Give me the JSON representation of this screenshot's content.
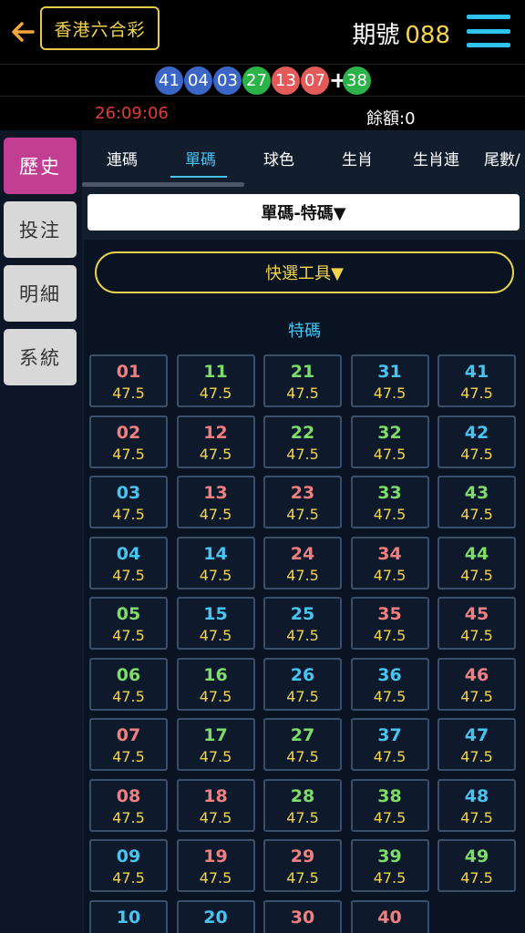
{
  "header": {
    "lottery_name": "香港六合彩",
    "period_label": "期號",
    "period_number": "088",
    "back_icon": "arrow-left-icon",
    "menu_icon": "hamburger-menu-icon"
  },
  "last_draw": {
    "balls": [
      {
        "number": "41",
        "color": "#3b66c8"
      },
      {
        "number": "04",
        "color": "#3b66c8"
      },
      {
        "number": "03",
        "color": "#3b66c8"
      },
      {
        "number": "27",
        "color": "#2bb34a"
      },
      {
        "number": "13",
        "color": "#e35a5a"
      },
      {
        "number": "07",
        "color": "#e35a5a"
      }
    ],
    "plus": "+",
    "special": {
      "number": "38",
      "color": "#2bb34a"
    }
  },
  "status": {
    "countdown": "26:09:06",
    "balance": "餘額:0"
  },
  "sidebar": {
    "items": [
      {
        "label": "歷史",
        "active": true
      },
      {
        "label": "投注",
        "active": false
      },
      {
        "label": "明細",
        "active": false
      },
      {
        "label": "系統",
        "active": false
      }
    ]
  },
  "tabs": [
    {
      "label": "連碼",
      "active": false
    },
    {
      "label": "單碼",
      "active": true
    },
    {
      "label": "球色",
      "active": false
    },
    {
      "label": "生肖",
      "active": false
    },
    {
      "label": "生肖連",
      "active": false
    },
    {
      "label": "尾數/",
      "active": false
    }
  ],
  "selector": {
    "label": "單碼-特碼▼"
  },
  "quick_tool": {
    "label": "快選工具▼"
  },
  "section": {
    "title": "特碼"
  },
  "colors": {
    "red": "#f08080",
    "blue": "#49c3f0",
    "green": "#7ddc6a",
    "odds": "#f2d44d"
  },
  "numbers": [
    {
      "n": "01",
      "c": "red",
      "odds": "47.5"
    },
    {
      "n": "11",
      "c": "green",
      "odds": "47.5"
    },
    {
      "n": "21",
      "c": "green",
      "odds": "47.5"
    },
    {
      "n": "31",
      "c": "blue",
      "odds": "47.5"
    },
    {
      "n": "41",
      "c": "blue",
      "odds": "47.5"
    },
    {
      "n": "02",
      "c": "red",
      "odds": "47.5"
    },
    {
      "n": "12",
      "c": "red",
      "odds": "47.5"
    },
    {
      "n": "22",
      "c": "green",
      "odds": "47.5"
    },
    {
      "n": "32",
      "c": "green",
      "odds": "47.5"
    },
    {
      "n": "42",
      "c": "blue",
      "odds": "47.5"
    },
    {
      "n": "03",
      "c": "blue",
      "odds": "47.5"
    },
    {
      "n": "13",
      "c": "red",
      "odds": "47.5"
    },
    {
      "n": "23",
      "c": "red",
      "odds": "47.5"
    },
    {
      "n": "33",
      "c": "green",
      "odds": "47.5"
    },
    {
      "n": "43",
      "c": "green",
      "odds": "47.5"
    },
    {
      "n": "04",
      "c": "blue",
      "odds": "47.5"
    },
    {
      "n": "14",
      "c": "blue",
      "odds": "47.5"
    },
    {
      "n": "24",
      "c": "red",
      "odds": "47.5"
    },
    {
      "n": "34",
      "c": "red",
      "odds": "47.5"
    },
    {
      "n": "44",
      "c": "green",
      "odds": "47.5"
    },
    {
      "n": "05",
      "c": "green",
      "odds": "47.5"
    },
    {
      "n": "15",
      "c": "blue",
      "odds": "47.5"
    },
    {
      "n": "25",
      "c": "blue",
      "odds": "47.5"
    },
    {
      "n": "35",
      "c": "red",
      "odds": "47.5"
    },
    {
      "n": "45",
      "c": "red",
      "odds": "47.5"
    },
    {
      "n": "06",
      "c": "green",
      "odds": "47.5"
    },
    {
      "n": "16",
      "c": "green",
      "odds": "47.5"
    },
    {
      "n": "26",
      "c": "blue",
      "odds": "47.5"
    },
    {
      "n": "36",
      "c": "blue",
      "odds": "47.5"
    },
    {
      "n": "46",
      "c": "red",
      "odds": "47.5"
    },
    {
      "n": "07",
      "c": "red",
      "odds": "47.5"
    },
    {
      "n": "17",
      "c": "green",
      "odds": "47.5"
    },
    {
      "n": "27",
      "c": "green",
      "odds": "47.5"
    },
    {
      "n": "37",
      "c": "blue",
      "odds": "47.5"
    },
    {
      "n": "47",
      "c": "blue",
      "odds": "47.5"
    },
    {
      "n": "08",
      "c": "red",
      "odds": "47.5"
    },
    {
      "n": "18",
      "c": "red",
      "odds": "47.5"
    },
    {
      "n": "28",
      "c": "green",
      "odds": "47.5"
    },
    {
      "n": "38",
      "c": "green",
      "odds": "47.5"
    },
    {
      "n": "48",
      "c": "blue",
      "odds": "47.5"
    },
    {
      "n": "09",
      "c": "blue",
      "odds": "47.5"
    },
    {
      "n": "19",
      "c": "red",
      "odds": "47.5"
    },
    {
      "n": "29",
      "c": "red",
      "odds": "47.5"
    },
    {
      "n": "39",
      "c": "green",
      "odds": "47.5"
    },
    {
      "n": "49",
      "c": "green",
      "odds": "47.5"
    },
    {
      "n": "10",
      "c": "blue",
      "odds": ""
    },
    {
      "n": "20",
      "c": "blue",
      "odds": ""
    },
    {
      "n": "30",
      "c": "red",
      "odds": ""
    },
    {
      "n": "40",
      "c": "red",
      "odds": ""
    }
  ]
}
